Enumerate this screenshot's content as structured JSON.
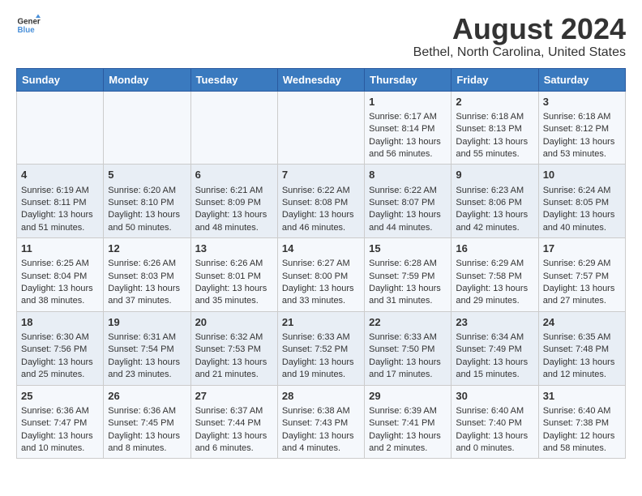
{
  "header": {
    "logo_line1": "General",
    "logo_line2": "Blue",
    "main_title": "August 2024",
    "subtitle": "Bethel, North Carolina, United States"
  },
  "weekdays": [
    "Sunday",
    "Monday",
    "Tuesday",
    "Wednesday",
    "Thursday",
    "Friday",
    "Saturday"
  ],
  "weeks": [
    [
      {
        "day": "",
        "info": ""
      },
      {
        "day": "",
        "info": ""
      },
      {
        "day": "",
        "info": ""
      },
      {
        "day": "",
        "info": ""
      },
      {
        "day": "1",
        "sunrise": "Sunrise: 6:17 AM",
        "sunset": "Sunset: 8:14 PM",
        "daylight": "Daylight: 13 hours and 56 minutes."
      },
      {
        "day": "2",
        "sunrise": "Sunrise: 6:18 AM",
        "sunset": "Sunset: 8:13 PM",
        "daylight": "Daylight: 13 hours and 55 minutes."
      },
      {
        "day": "3",
        "sunrise": "Sunrise: 6:18 AM",
        "sunset": "Sunset: 8:12 PM",
        "daylight": "Daylight: 13 hours and 53 minutes."
      }
    ],
    [
      {
        "day": "4",
        "sunrise": "Sunrise: 6:19 AM",
        "sunset": "Sunset: 8:11 PM",
        "daylight": "Daylight: 13 hours and 51 minutes."
      },
      {
        "day": "5",
        "sunrise": "Sunrise: 6:20 AM",
        "sunset": "Sunset: 8:10 PM",
        "daylight": "Daylight: 13 hours and 50 minutes."
      },
      {
        "day": "6",
        "sunrise": "Sunrise: 6:21 AM",
        "sunset": "Sunset: 8:09 PM",
        "daylight": "Daylight: 13 hours and 48 minutes."
      },
      {
        "day": "7",
        "sunrise": "Sunrise: 6:22 AM",
        "sunset": "Sunset: 8:08 PM",
        "daylight": "Daylight: 13 hours and 46 minutes."
      },
      {
        "day": "8",
        "sunrise": "Sunrise: 6:22 AM",
        "sunset": "Sunset: 8:07 PM",
        "daylight": "Daylight: 13 hours and 44 minutes."
      },
      {
        "day": "9",
        "sunrise": "Sunrise: 6:23 AM",
        "sunset": "Sunset: 8:06 PM",
        "daylight": "Daylight: 13 hours and 42 minutes."
      },
      {
        "day": "10",
        "sunrise": "Sunrise: 6:24 AM",
        "sunset": "Sunset: 8:05 PM",
        "daylight": "Daylight: 13 hours and 40 minutes."
      }
    ],
    [
      {
        "day": "11",
        "sunrise": "Sunrise: 6:25 AM",
        "sunset": "Sunset: 8:04 PM",
        "daylight": "Daylight: 13 hours and 38 minutes."
      },
      {
        "day": "12",
        "sunrise": "Sunrise: 6:26 AM",
        "sunset": "Sunset: 8:03 PM",
        "daylight": "Daylight: 13 hours and 37 minutes."
      },
      {
        "day": "13",
        "sunrise": "Sunrise: 6:26 AM",
        "sunset": "Sunset: 8:01 PM",
        "daylight": "Daylight: 13 hours and 35 minutes."
      },
      {
        "day": "14",
        "sunrise": "Sunrise: 6:27 AM",
        "sunset": "Sunset: 8:00 PM",
        "daylight": "Daylight: 13 hours and 33 minutes."
      },
      {
        "day": "15",
        "sunrise": "Sunrise: 6:28 AM",
        "sunset": "Sunset: 7:59 PM",
        "daylight": "Daylight: 13 hours and 31 minutes."
      },
      {
        "day": "16",
        "sunrise": "Sunrise: 6:29 AM",
        "sunset": "Sunset: 7:58 PM",
        "daylight": "Daylight: 13 hours and 29 minutes."
      },
      {
        "day": "17",
        "sunrise": "Sunrise: 6:29 AM",
        "sunset": "Sunset: 7:57 PM",
        "daylight": "Daylight: 13 hours and 27 minutes."
      }
    ],
    [
      {
        "day": "18",
        "sunrise": "Sunrise: 6:30 AM",
        "sunset": "Sunset: 7:56 PM",
        "daylight": "Daylight: 13 hours and 25 minutes."
      },
      {
        "day": "19",
        "sunrise": "Sunrise: 6:31 AM",
        "sunset": "Sunset: 7:54 PM",
        "daylight": "Daylight: 13 hours and 23 minutes."
      },
      {
        "day": "20",
        "sunrise": "Sunrise: 6:32 AM",
        "sunset": "Sunset: 7:53 PM",
        "daylight": "Daylight: 13 hours and 21 minutes."
      },
      {
        "day": "21",
        "sunrise": "Sunrise: 6:33 AM",
        "sunset": "Sunset: 7:52 PM",
        "daylight": "Daylight: 13 hours and 19 minutes."
      },
      {
        "day": "22",
        "sunrise": "Sunrise: 6:33 AM",
        "sunset": "Sunset: 7:50 PM",
        "daylight": "Daylight: 13 hours and 17 minutes."
      },
      {
        "day": "23",
        "sunrise": "Sunrise: 6:34 AM",
        "sunset": "Sunset: 7:49 PM",
        "daylight": "Daylight: 13 hours and 15 minutes."
      },
      {
        "day": "24",
        "sunrise": "Sunrise: 6:35 AM",
        "sunset": "Sunset: 7:48 PM",
        "daylight": "Daylight: 13 hours and 12 minutes."
      }
    ],
    [
      {
        "day": "25",
        "sunrise": "Sunrise: 6:36 AM",
        "sunset": "Sunset: 7:47 PM",
        "daylight": "Daylight: 13 hours and 10 minutes."
      },
      {
        "day": "26",
        "sunrise": "Sunrise: 6:36 AM",
        "sunset": "Sunset: 7:45 PM",
        "daylight": "Daylight: 13 hours and 8 minutes."
      },
      {
        "day": "27",
        "sunrise": "Sunrise: 6:37 AM",
        "sunset": "Sunset: 7:44 PM",
        "daylight": "Daylight: 13 hours and 6 minutes."
      },
      {
        "day": "28",
        "sunrise": "Sunrise: 6:38 AM",
        "sunset": "Sunset: 7:43 PM",
        "daylight": "Daylight: 13 hours and 4 minutes."
      },
      {
        "day": "29",
        "sunrise": "Sunrise: 6:39 AM",
        "sunset": "Sunset: 7:41 PM",
        "daylight": "Daylight: 13 hours and 2 minutes."
      },
      {
        "day": "30",
        "sunrise": "Sunrise: 6:40 AM",
        "sunset": "Sunset: 7:40 PM",
        "daylight": "Daylight: 13 hours and 0 minutes."
      },
      {
        "day": "31",
        "sunrise": "Sunrise: 6:40 AM",
        "sunset": "Sunset: 7:38 PM",
        "daylight": "Daylight: 12 hours and 58 minutes."
      }
    ]
  ]
}
